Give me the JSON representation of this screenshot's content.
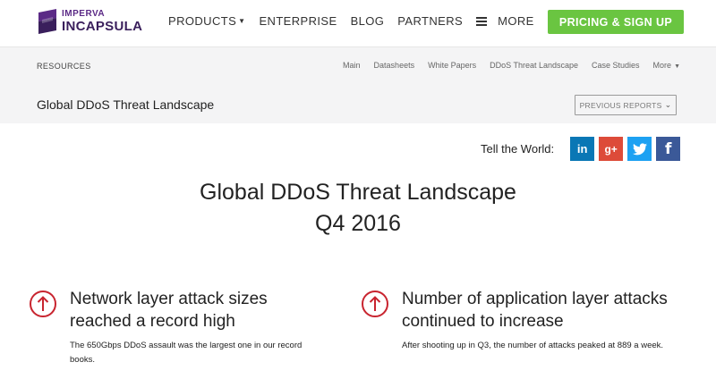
{
  "nav": {
    "logo": {
      "top": "IMPERVA",
      "bottom": "INCAPSULA"
    },
    "items": [
      "PRODUCTS",
      "ENTERPRISE",
      "BLOG",
      "PARTNERS"
    ],
    "more": "MORE",
    "cta": "PRICING & SIGN UP"
  },
  "resources": {
    "label": "RESOURCES",
    "links": [
      "Main",
      "Datasheets",
      "White Papers",
      "DDoS Threat Landscape",
      "Case Studies",
      "More"
    ]
  },
  "titlebar": {
    "title": "Global DDoS Threat Landscape",
    "prev_reports": "PREVIOUS REPORTS"
  },
  "share": {
    "label": "Tell the World:",
    "icons": [
      "linkedin-icon",
      "google-plus-icon",
      "twitter-icon",
      "facebook-icon"
    ]
  },
  "headline": {
    "line1": "Global DDoS Threat Landscape",
    "line2": "Q4 2016"
  },
  "stats": [
    {
      "title_line1": "Network layer attack sizes",
      "title_line2": "reached a record high",
      "desc": "The 650Gbps DDoS assault was the largest one in our record books."
    },
    {
      "title_line1": "Number of application layer attacks",
      "title_line2": "continued to increase",
      "desc": "After shooting up in Q3, the number of attacks peaked at 889 a week."
    }
  ],
  "colors": {
    "cta": "#6ac541",
    "brand": "#5b2a86",
    "stat_icon": "#c8242f",
    "linkedin": "#0a77b5",
    "google_plus": "#dd4b39",
    "twitter": "#1da1f2",
    "facebook": "#3b5998"
  }
}
